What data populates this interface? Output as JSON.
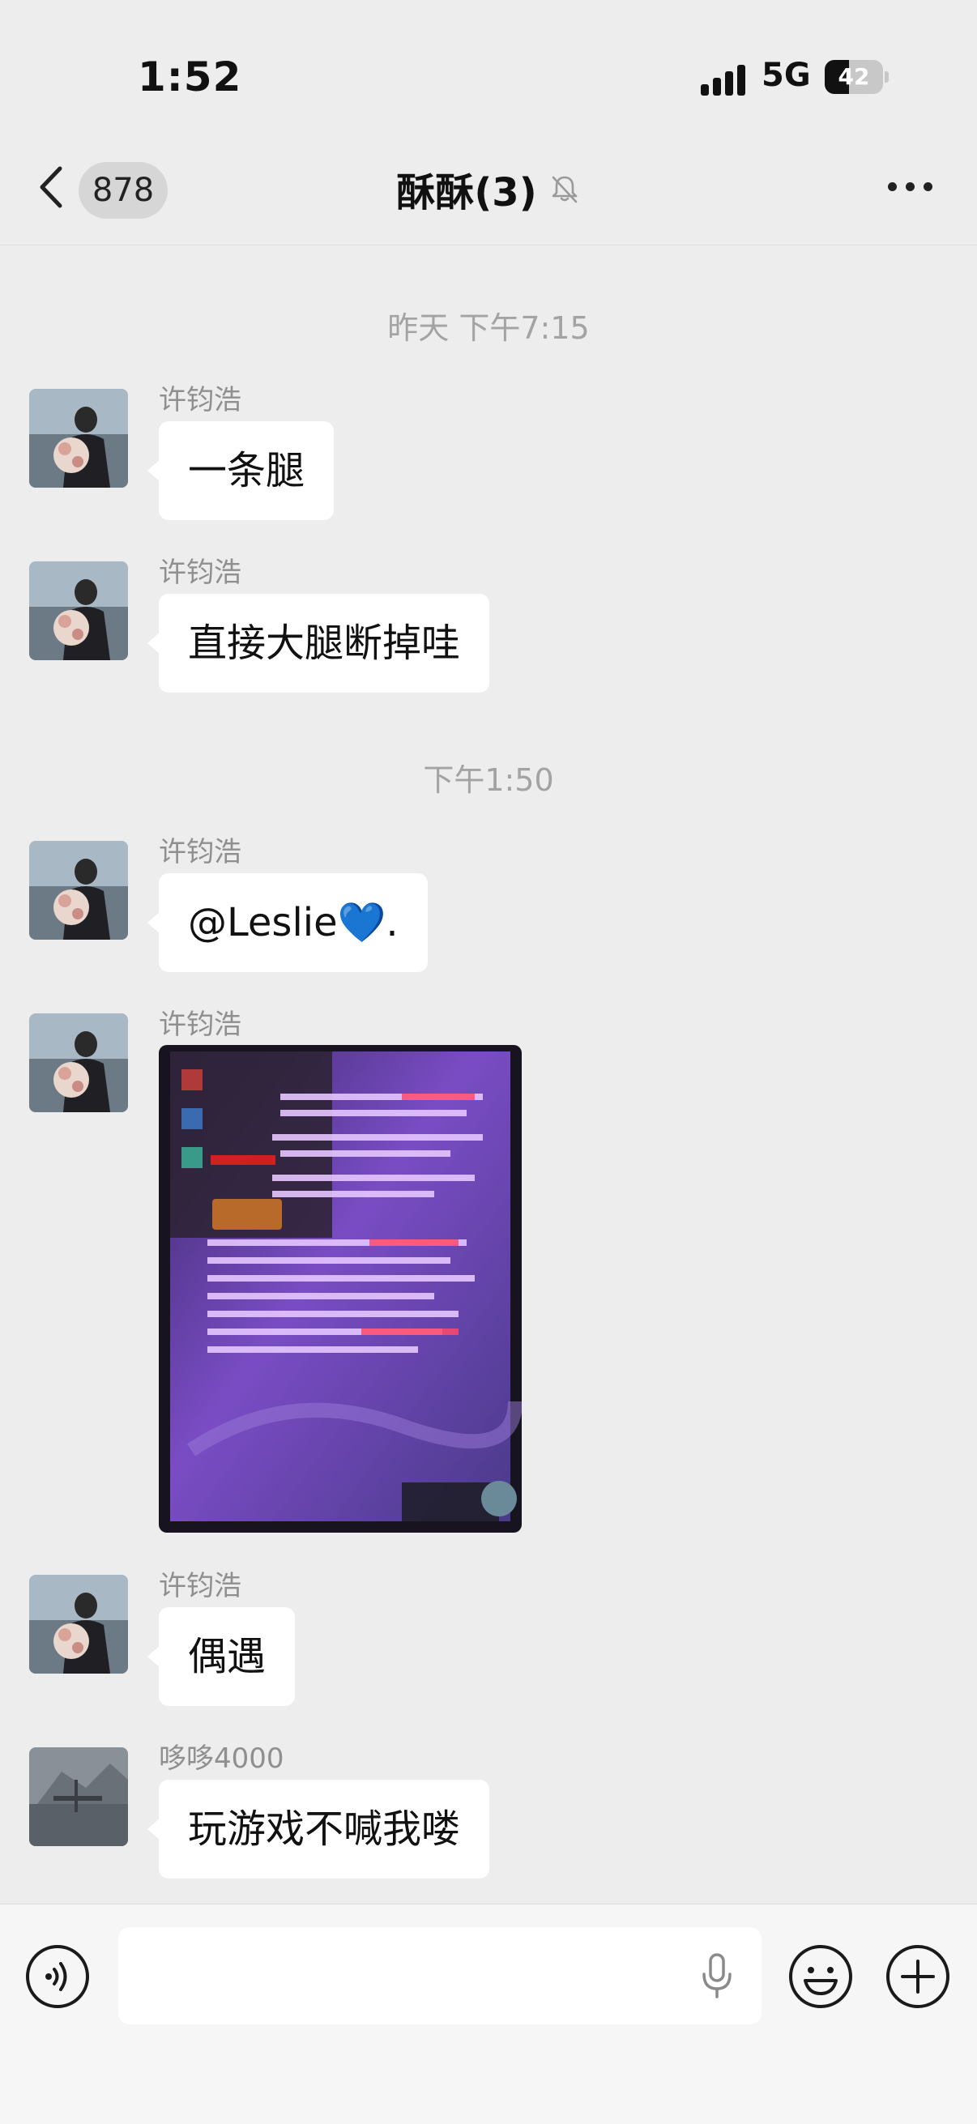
{
  "status_bar": {
    "time": "1:52",
    "network": "5G",
    "battery": "42",
    "battery_level": 0.42
  },
  "nav": {
    "unread_count": "878",
    "chat_title": "酥酥(3)",
    "icons": [
      "back-chevron-icon",
      "mute-bell-icon",
      "more-dots-icon"
    ]
  },
  "messages": {
    "timestamp_1": "昨天 下午7:15",
    "timestamp_2": "下午1:50",
    "m1": {
      "sender": "许钧浩",
      "text": "一条腿"
    },
    "m2": {
      "sender": "许钧浩",
      "text": "直接大腿断掉哇"
    },
    "m3": {
      "sender": "许钧浩",
      "text": "@Leslie",
      "emoji": "💙",
      "suffix": "."
    },
    "m4": {
      "sender": "许钧浩",
      "image": "game-screenshot"
    },
    "m5": {
      "sender": "许钧浩",
      "text": "偶遇"
    },
    "m6": {
      "sender": "哆哆4000",
      "text": "玩游戏不喊我喽"
    }
  },
  "input_bar": {
    "icons": [
      "voice-icon",
      "mic-icon",
      "emoji-icon",
      "plus-icon"
    ],
    "text_value": ""
  },
  "colors": {
    "background": "#ededed",
    "bubble": "#ffffff",
    "heart": "#2f86e6"
  }
}
